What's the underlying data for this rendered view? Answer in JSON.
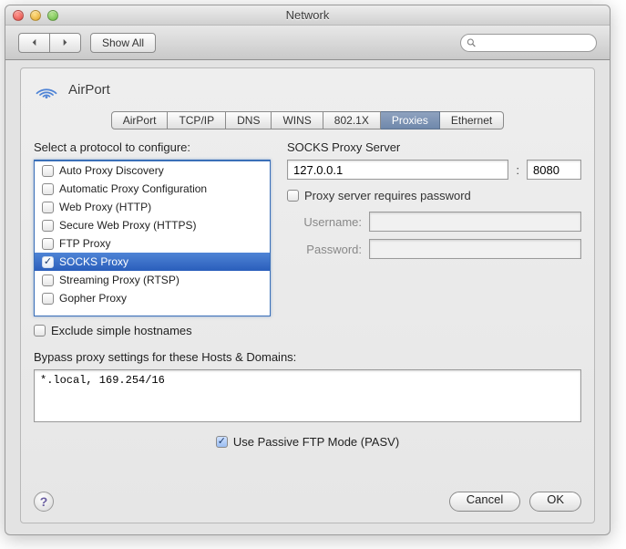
{
  "window": {
    "title": "Network"
  },
  "toolbar": {
    "back_label": "◀",
    "forward_label": "▶",
    "show_all_label": "Show All",
    "search_placeholder": ""
  },
  "sheet": {
    "connection_name": "AirPort",
    "tabs": [
      {
        "label": "AirPort",
        "selected": false
      },
      {
        "label": "TCP/IP",
        "selected": false
      },
      {
        "label": "DNS",
        "selected": false
      },
      {
        "label": "WINS",
        "selected": false
      },
      {
        "label": "802.1X",
        "selected": false
      },
      {
        "label": "Proxies",
        "selected": true
      },
      {
        "label": "Ethernet",
        "selected": false
      }
    ],
    "protocol_label": "Select a protocol to configure:",
    "protocols": [
      {
        "label": "Auto Proxy Discovery",
        "checked": false,
        "selected": false
      },
      {
        "label": "Automatic Proxy Configuration",
        "checked": false,
        "selected": false
      },
      {
        "label": "Web Proxy (HTTP)",
        "checked": false,
        "selected": false
      },
      {
        "label": "Secure Web Proxy (HTTPS)",
        "checked": false,
        "selected": false
      },
      {
        "label": "FTP Proxy",
        "checked": false,
        "selected": false
      },
      {
        "label": "SOCKS Proxy",
        "checked": true,
        "selected": true
      },
      {
        "label": "Streaming Proxy (RTSP)",
        "checked": false,
        "selected": false
      },
      {
        "label": "Gopher Proxy",
        "checked": false,
        "selected": false
      }
    ],
    "exclude_simple_label": "Exclude simple hostnames",
    "exclude_simple_checked": false,
    "server_label": "SOCKS Proxy Server",
    "server_host": "127.0.0.1",
    "server_port": "8080",
    "requires_password_label": "Proxy server requires password",
    "requires_password_checked": false,
    "username_label": "Username:",
    "username_value": "",
    "password_label": "Password:",
    "password_value": "",
    "bypass_label": "Bypass proxy settings for these Hosts & Domains:",
    "bypass_value": "*.local, 169.254/16",
    "pasv_label": "Use Passive FTP Mode (PASV)",
    "pasv_checked": true,
    "help_label": "?",
    "cancel_label": "Cancel",
    "ok_label": "OK"
  }
}
